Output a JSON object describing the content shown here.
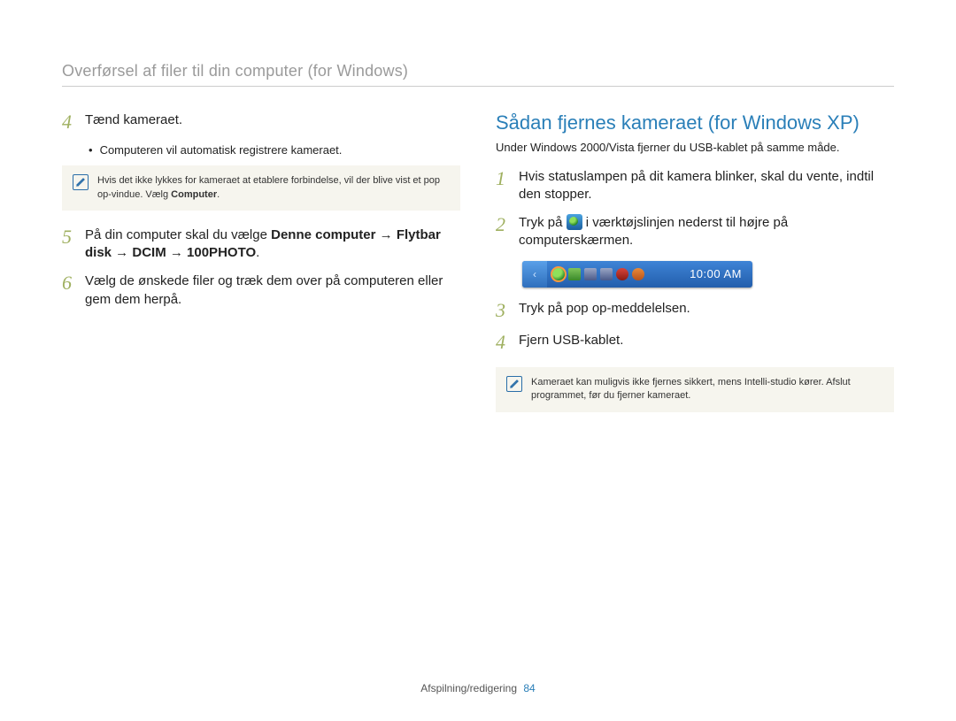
{
  "header": {
    "title": "Overførsel af filer til din computer (for Windows)"
  },
  "left": {
    "step4_num": "4",
    "step4_text": "Tænd kameraet.",
    "step4_bullet": "Computeren vil automatisk registrere kameraet.",
    "note1_pre": "Hvis det ikke lykkes for kameraet at etablere forbindelse, vil der blive vist et pop op-vindue. Vælg ",
    "note1_bold": "Computer",
    "note1_post": ".",
    "step5_num": "5",
    "step5_pre": "På din computer skal du vælge ",
    "step5_b1": "Denne computer",
    "step5_arrow": " → ",
    "step5_b2": "Flytbar disk",
    "step5_b3": "DCIM",
    "step5_b4": "100PHOTO",
    "step5_post": ".",
    "step6_num": "6",
    "step6_text": "Vælg de ønskede filer og træk dem over på computeren eller gem dem herpå."
  },
  "right": {
    "heading": "Sådan fjernes kameraet (for Windows XP)",
    "sub": "Under Windows 2000/Vista fjerner du USB-kablet på samme måde.",
    "step1_num": "1",
    "step1_text": "Hvis statuslampen på dit kamera blinker, skal du vente, indtil den stopper.",
    "step2_num": "2",
    "step2_pre": "Tryk på ",
    "step2_post": " i værktøjslinjen nederst til højre på computerskærmen.",
    "tray_time": "10:00 AM",
    "step3_num": "3",
    "step3_text": "Tryk på pop op-meddelelsen.",
    "step4_num": "4",
    "step4_text": "Fjern USB-kablet.",
    "note2_text": "Kameraet kan muligvis ikke fjernes sikkert, mens Intelli-studio kører. Afslut programmet, før du fjerner kameraet."
  },
  "footer": {
    "section": "Afspilning/redigering",
    "page": "84"
  }
}
